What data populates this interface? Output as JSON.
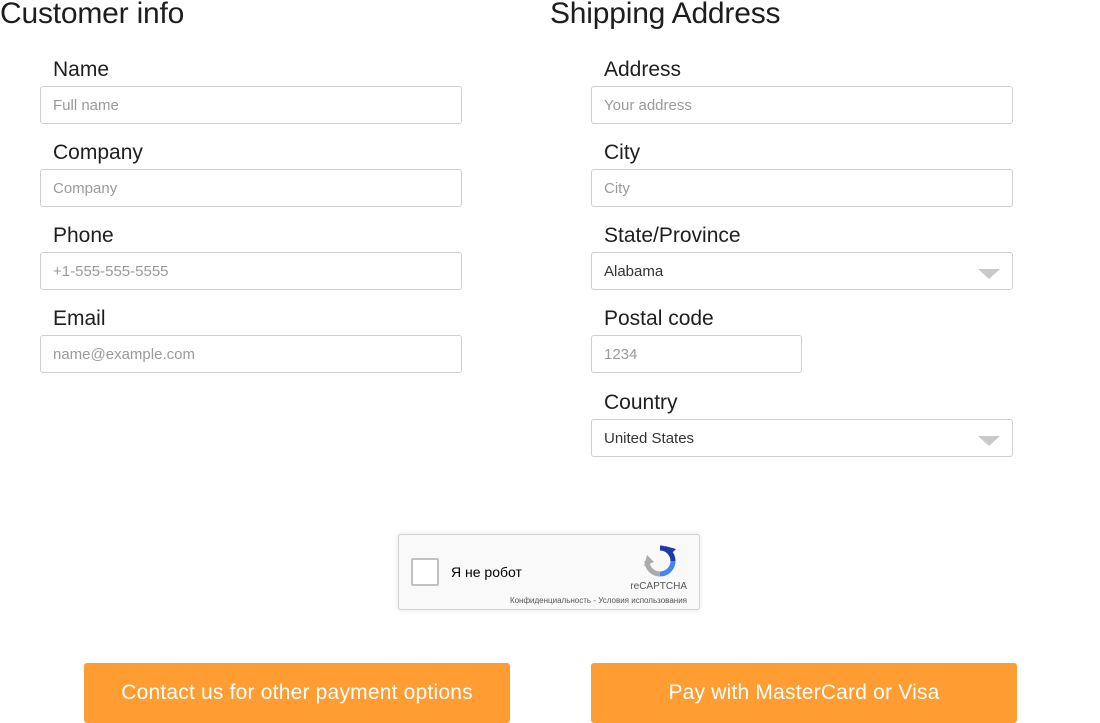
{
  "customer": {
    "title": "Customer info",
    "fields": {
      "name": {
        "label": "Name",
        "placeholder": "Full name",
        "value": ""
      },
      "company": {
        "label": "Company",
        "placeholder": "Company",
        "value": ""
      },
      "phone": {
        "label": "Phone",
        "placeholder": "+1-555-555-5555",
        "value": ""
      },
      "email": {
        "label": "Email",
        "placeholder": "name@example.com",
        "value": ""
      }
    }
  },
  "shipping": {
    "title": "Shipping Address",
    "fields": {
      "address": {
        "label": "Address",
        "placeholder": "Your address",
        "value": ""
      },
      "city": {
        "label": "City",
        "placeholder": "City",
        "value": ""
      },
      "state": {
        "label": "State/Province",
        "selected": "Alabama"
      },
      "postal": {
        "label": "Postal code",
        "placeholder": "1234",
        "value": ""
      },
      "country": {
        "label": "Country",
        "selected": "United States"
      }
    }
  },
  "recaptcha": {
    "label": "Я не робот",
    "brand": "reCAPTCHA",
    "privacy": "Конфиденциальность",
    "separator": " - ",
    "terms": "Условия использования",
    "icon": "recaptcha-logo-icon"
  },
  "actions": {
    "contact_label": "Contact us for other payment options",
    "pay_label": "Pay with MasterCard or Visa"
  },
  "colors": {
    "accent": "#ff9d33",
    "input_border": "#cfcfcf",
    "recaptcha_blue": "#4a90e2"
  }
}
